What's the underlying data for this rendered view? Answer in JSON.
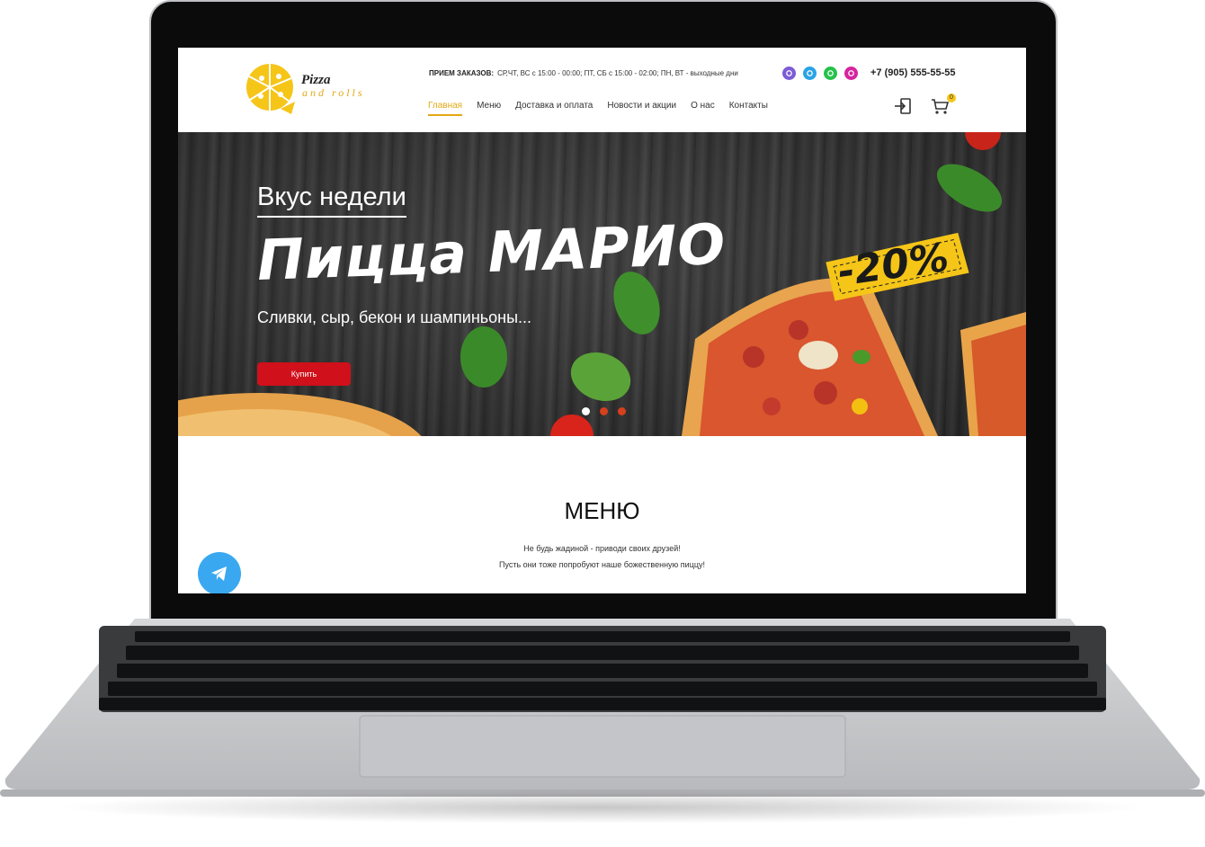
{
  "header": {
    "logo": {
      "word1": "Pizza",
      "word2": "and rolls"
    },
    "orders": {
      "label": "ПРИЕМ ЗАКАЗОВ:",
      "hours": "СР,ЧТ, ВС с 15:00 - 00:00; ПТ, СБ с 15:00 - 02:00; ПН, ВТ - выходные дни"
    },
    "socials": [
      {
        "name": "viber-icon",
        "color": "#7d5bd6"
      },
      {
        "name": "telegram-icon",
        "color": "#2aa3e6"
      },
      {
        "name": "whatsapp-icon",
        "color": "#25c24b"
      },
      {
        "name": "instagram-icon",
        "color": "#d6249f"
      }
    ],
    "phone": "+7 (905) 555-55-55",
    "nav": [
      "Главная",
      "Меню",
      "Доставка и оплата",
      "Новости и акции",
      "О нас",
      "Контакты"
    ],
    "active_nav": 0,
    "cart_count": "0"
  },
  "hero": {
    "subtitle": "Вкус недели",
    "title": "Пицца МАРИО",
    "description": "Сливки, сыр, бекон и шампиньоны...",
    "buy_label": "Купить",
    "discount": "-20%",
    "slide_count": 3,
    "active_slide": 0
  },
  "menu": {
    "title": "МЕНЮ",
    "line1": "Не будь жадиной - приводи своих друзей!",
    "line2": "Пусть они тоже попробуют наше божественную пиццу!"
  },
  "colors": {
    "accent": "#e3a812",
    "button": "#d0101a",
    "telegram": "#3aa8f0"
  }
}
